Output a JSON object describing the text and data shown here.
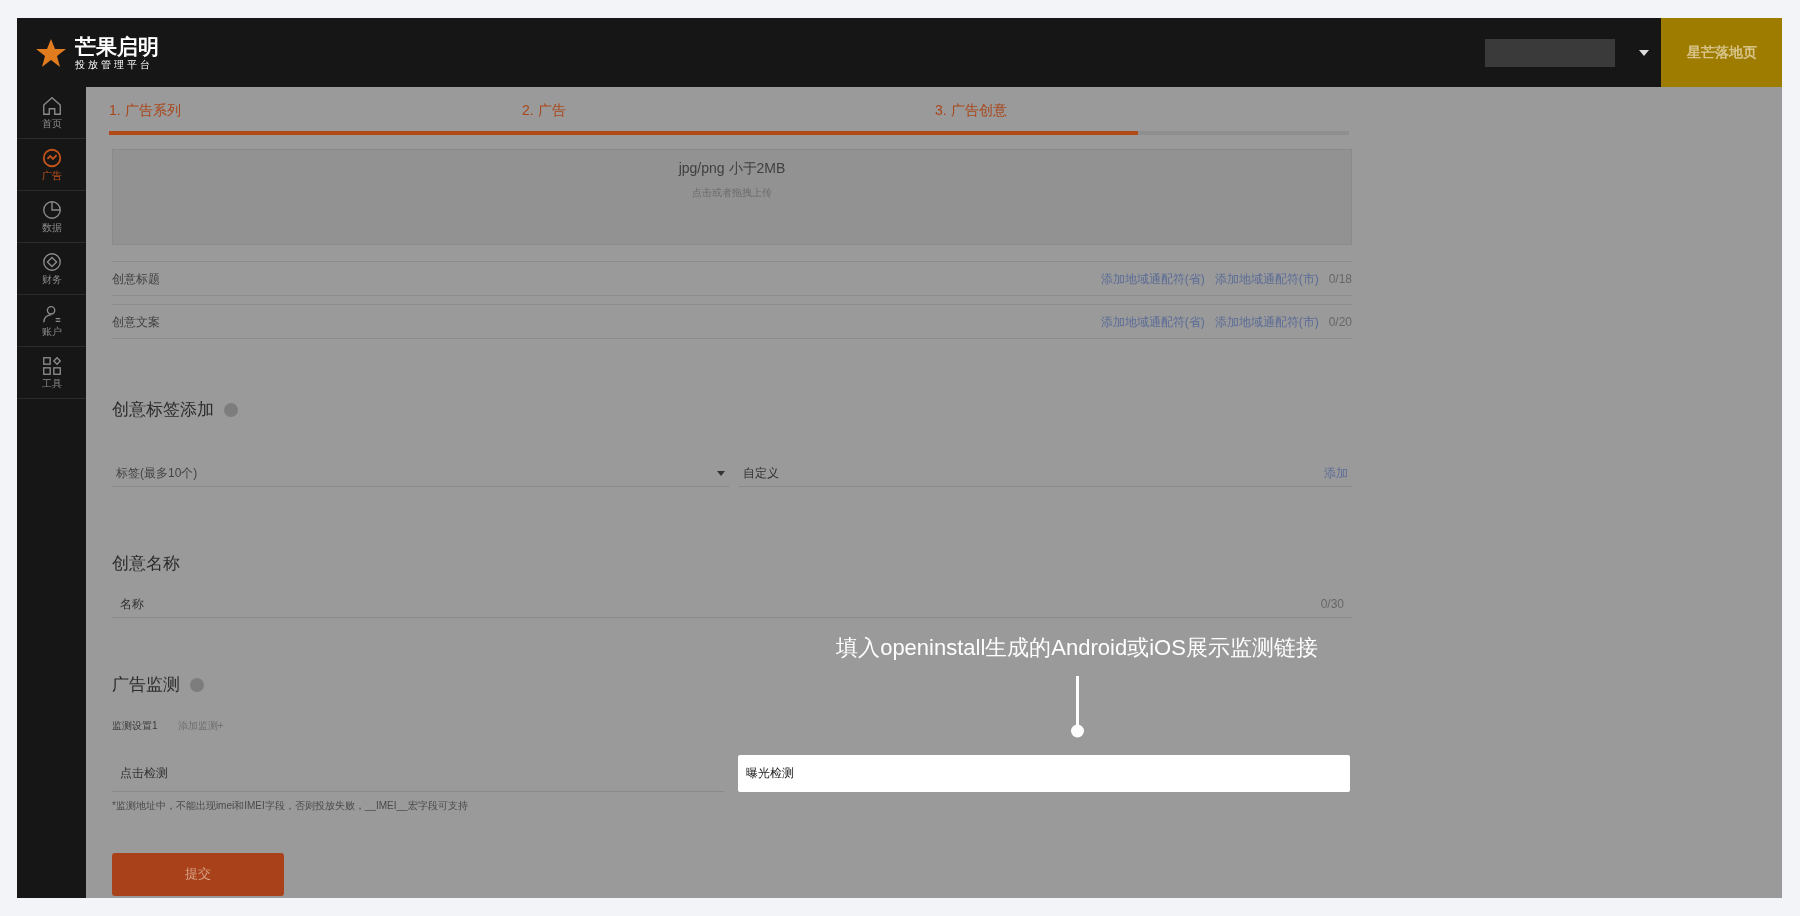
{
  "header": {
    "logo_title": "芒果启明",
    "logo_subtitle": "投放管理平台",
    "landing_button": "星芒落地页"
  },
  "sidebar": {
    "items": [
      {
        "label": "首页",
        "kind": "home",
        "selected": false
      },
      {
        "label": "广告",
        "kind": "ad",
        "selected": true
      },
      {
        "label": "数据",
        "kind": "data",
        "selected": false
      },
      {
        "label": "财务",
        "kind": "finance",
        "selected": false
      },
      {
        "label": "账户",
        "kind": "account",
        "selected": false
      },
      {
        "label": "工具",
        "kind": "tools",
        "selected": false
      }
    ]
  },
  "steps": {
    "items": [
      {
        "label": "1. 广告系列"
      },
      {
        "label": "2. 广告"
      },
      {
        "label": "3. 广告创意"
      }
    ],
    "level": 0.83
  },
  "upload": {
    "format": "jpg/png 小于2MB",
    "hint": "点击或者拖拽上传"
  },
  "creative_fields": [
    {
      "label": "创意标题",
      "links": [
        "添加地域通配符(省)",
        "添加地域通配符(市)"
      ],
      "count": "0/18"
    },
    {
      "label": "创意文案",
      "links": [
        "添加地域通配符(省)",
        "添加地域通配符(市)"
      ],
      "count": "0/20"
    }
  ],
  "tags": {
    "heading": "创意标签添加",
    "select_placeholder": "标签(最多10个)",
    "custom_label": "自定义",
    "add_link": "添加"
  },
  "name": {
    "heading": "创意名称",
    "label": "名称",
    "count": "0/30"
  },
  "monitoring": {
    "heading": "广告监测",
    "tabs": [
      {
        "label": "监测设置1",
        "selected": true
      },
      {
        "label": "添加监测+",
        "selected": false
      }
    ],
    "click_field": {
      "placeholder": "点击检测",
      "highlighted": false
    },
    "impression_field": {
      "placeholder": "曝光检测",
      "highlighted": true
    },
    "note": "*监测地址中，不能出现imei和IMEI字段，否则投放失败，__IMEI__宏字段可支持"
  },
  "annotation": "填入openinstall生成的Android或iOS展示监测链接",
  "submit_button": "提交"
}
